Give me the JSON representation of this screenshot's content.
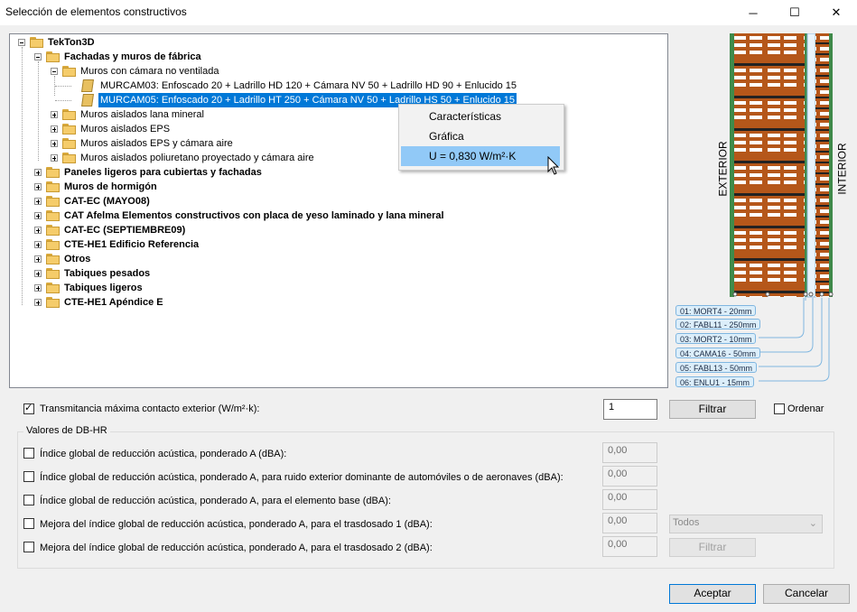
{
  "window": {
    "title": "Selección de elementos constructivos",
    "minimize": "─",
    "maximize": "☐",
    "close": "✕"
  },
  "tree": {
    "items": [
      {
        "label": "TekTon3D",
        "bold": true
      },
      {
        "label": "Fachadas y muros de fábrica",
        "bold": true
      },
      {
        "label": "Muros con cámara no ventilada",
        "bold": false
      },
      {
        "label": "MURCAM03: Enfoscado 20 + Ladrillo HD 120 + Cámara NV 50 + Ladrillo HD 90 + Enlucido 15",
        "bold": false
      },
      {
        "label": "MURCAM05: Enfoscado 20 + Ladrillo HT 250 + Cámara NV 50 + Ladrillo HS 50 + Enlucido 15",
        "bold": false,
        "selected": true
      },
      {
        "label": "Muros aislados lana mineral",
        "bold": false
      },
      {
        "label": "Muros aislados EPS",
        "bold": false
      },
      {
        "label": "Muros aislados EPS y cámara aire",
        "bold": false
      },
      {
        "label": "Muros aislados poliuretano proyectado y cámara aire",
        "bold": false
      },
      {
        "label": "Paneles ligeros para cubiertas y fachadas",
        "bold": true
      },
      {
        "label": "Muros de hormigón",
        "bold": true
      },
      {
        "label": "CAT-EC (MAYO08)",
        "bold": true
      },
      {
        "label": "CAT Afelma Elementos constructivos con placa de yeso laminado y lana mineral",
        "bold": true
      },
      {
        "label": "CAT-EC (SEPTIEMBRE09)",
        "bold": true
      },
      {
        "label": "CTE-HE1 Edificio Referencia",
        "bold": true
      },
      {
        "label": "Otros",
        "bold": true
      },
      {
        "label": "Tabiques pesados",
        "bold": true
      },
      {
        "label": "Tabiques ligeros",
        "bold": true
      },
      {
        "label": "CTE-HE1 Apéndice E",
        "bold": true
      }
    ]
  },
  "context_menu": {
    "items": [
      "Características",
      "Gráfica",
      "U = 0,830 W/m²·K"
    ],
    "highlighted_index": 2
  },
  "layers_panel": {
    "exterior_label": "EXTERIOR",
    "interior_label": "INTERIOR",
    "brick_color": "#b5571a",
    "layers": [
      "01: MORT4 - 20mm",
      "02: FABL11 - 250mm",
      "03: MORT2 - 10mm",
      "04: CAMA16 - 50mm",
      "05: FABL13 - 50mm",
      "06: ENLU1 - 15mm"
    ]
  },
  "filter": {
    "transmitance_label": "Transmitancia máxima contacto exterior (W/m²·k):",
    "transmitance_checked": true,
    "transmitance_value": "1",
    "filter_button": "Filtrar",
    "order_label": "Ordenar",
    "order_checked": false
  },
  "dbhr": {
    "group_title": "Valores de DB-HR",
    "rows": [
      {
        "label": "Índice global de reducción acústica, ponderado A (dBA):",
        "value": "0,00"
      },
      {
        "label": "Índice global de reducción acústica, ponderado A, para ruido exterior dominante de automóviles  o de aeronaves (dBA):",
        "value": "0,00"
      },
      {
        "label": "Índice global de reducción acústica, ponderado A, para el elemento base (dBA):",
        "value": "0,00"
      },
      {
        "label": "Mejora del índice global de reducción acústica, ponderado A, para el trasdosado 1 (dBA):",
        "value": "0,00"
      },
      {
        "label": "Mejora del índice global de reducción acústica, ponderado A, para el trasdosado 2 (dBA):",
        "value": "0,00"
      }
    ],
    "select_value": "Todos",
    "filter_button": "Filtrar"
  },
  "footer": {
    "accept": "Aceptar",
    "cancel": "Cancelar"
  }
}
